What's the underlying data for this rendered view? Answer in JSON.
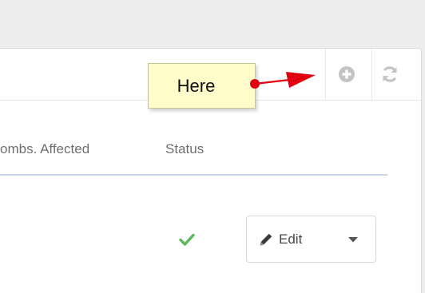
{
  "header": {
    "add_icon": "plus-circle-icon",
    "refresh_icon": "refresh-icon"
  },
  "table": {
    "columns": [
      "ombs. Affected",
      "Status"
    ],
    "row": {
      "status_icon": "check-icon",
      "actions": {
        "edit_label": "Edit",
        "edit_icon": "pencil-icon",
        "menu_icon": "caret-down-icon"
      }
    }
  },
  "annotation": {
    "label": "Here",
    "color": "#e0000f"
  },
  "colors": {
    "check": "#5cb85c",
    "toolbar_icon": "#c4c4c4",
    "header_rule": "#c9d6e6"
  }
}
